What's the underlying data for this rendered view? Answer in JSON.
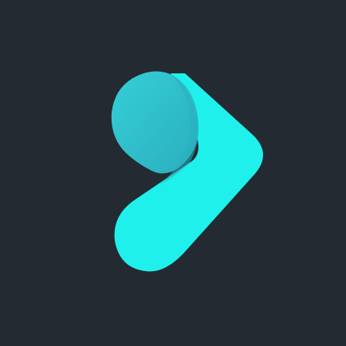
{
  "app_icon": {
    "icon": "play-arrow-logo-icon",
    "background_color": "#232a31",
    "colors": {
      "primary": "#1ff0ec",
      "top_lobe": "#35cfd7",
      "fold_shadow": "#2aaebe"
    }
  }
}
